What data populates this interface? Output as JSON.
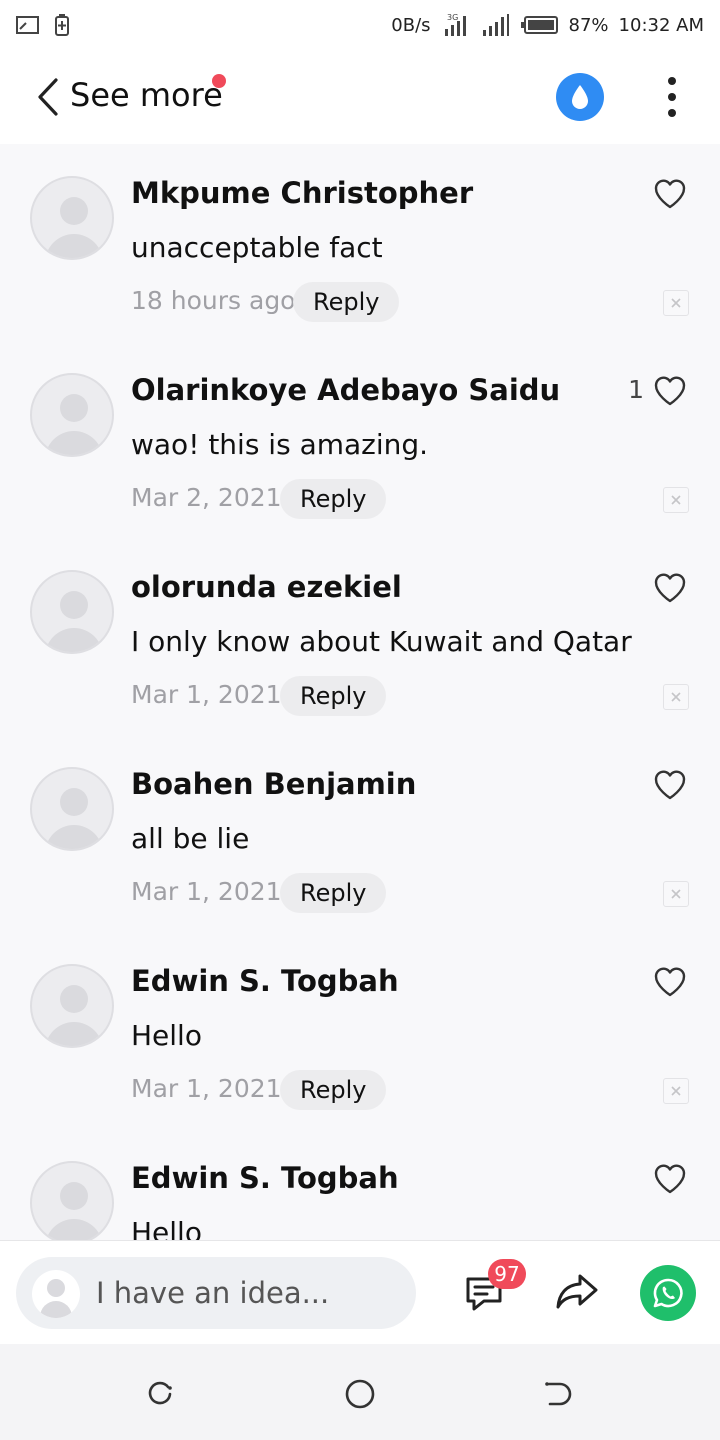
{
  "status_bar": {
    "net_speed": "0B/s",
    "network_type": "3G",
    "battery_percent": "87%",
    "time": "10:32 AM",
    "icons": [
      "screen-cast-icon",
      "battery-saver-icon",
      "signal-3g-icon",
      "signal-icon",
      "battery-icon"
    ]
  },
  "header": {
    "back_icon": "chevron-left-icon",
    "title": "See more",
    "notification_dot_color": "#f04a5a",
    "drop_icon": "water-drop-icon",
    "drop_color": "#2f8cf3",
    "more_icon": "more-vertical-icon"
  },
  "comments": [
    {
      "name": "Mkpume Christopher",
      "text": "unacceptable fact",
      "time": "18 hours ago",
      "reply_label": "Reply",
      "likes": ""
    },
    {
      "name": "Olarinkoye Adebayo Saidu",
      "text": "wao! this is amazing.",
      "time": "Mar 2, 2021",
      "reply_label": "Reply",
      "likes": "1"
    },
    {
      "name": "olorunda ezekiel",
      "text": "I only know about Kuwait and Qatar",
      "time": "Mar 1, 2021",
      "reply_label": "Reply",
      "likes": ""
    },
    {
      "name": "Boahen Benjamin",
      "text": "all be lie",
      "time": "Mar 1, 2021",
      "reply_label": "Reply",
      "likes": ""
    },
    {
      "name": "Edwin S. Togbah",
      "text": "Hello",
      "time": "Mar 1, 2021",
      "reply_label": "Reply",
      "likes": ""
    },
    {
      "name": "Edwin S. Togbah",
      "text": "Hello",
      "time": "",
      "reply_label": "",
      "likes": ""
    }
  ],
  "bottom_bar": {
    "input_placeholder": "I have an idea...",
    "comment_count": "97",
    "badge_color": "#f04a5a",
    "comment_icon": "comment-icon",
    "share_icon": "share-icon",
    "whatsapp_icon": "whatsapp-icon",
    "whatsapp_color": "#1fbf6b"
  },
  "nav_bar": {
    "icons": [
      "recent-apps-icon",
      "home-icon",
      "back-icon"
    ]
  }
}
